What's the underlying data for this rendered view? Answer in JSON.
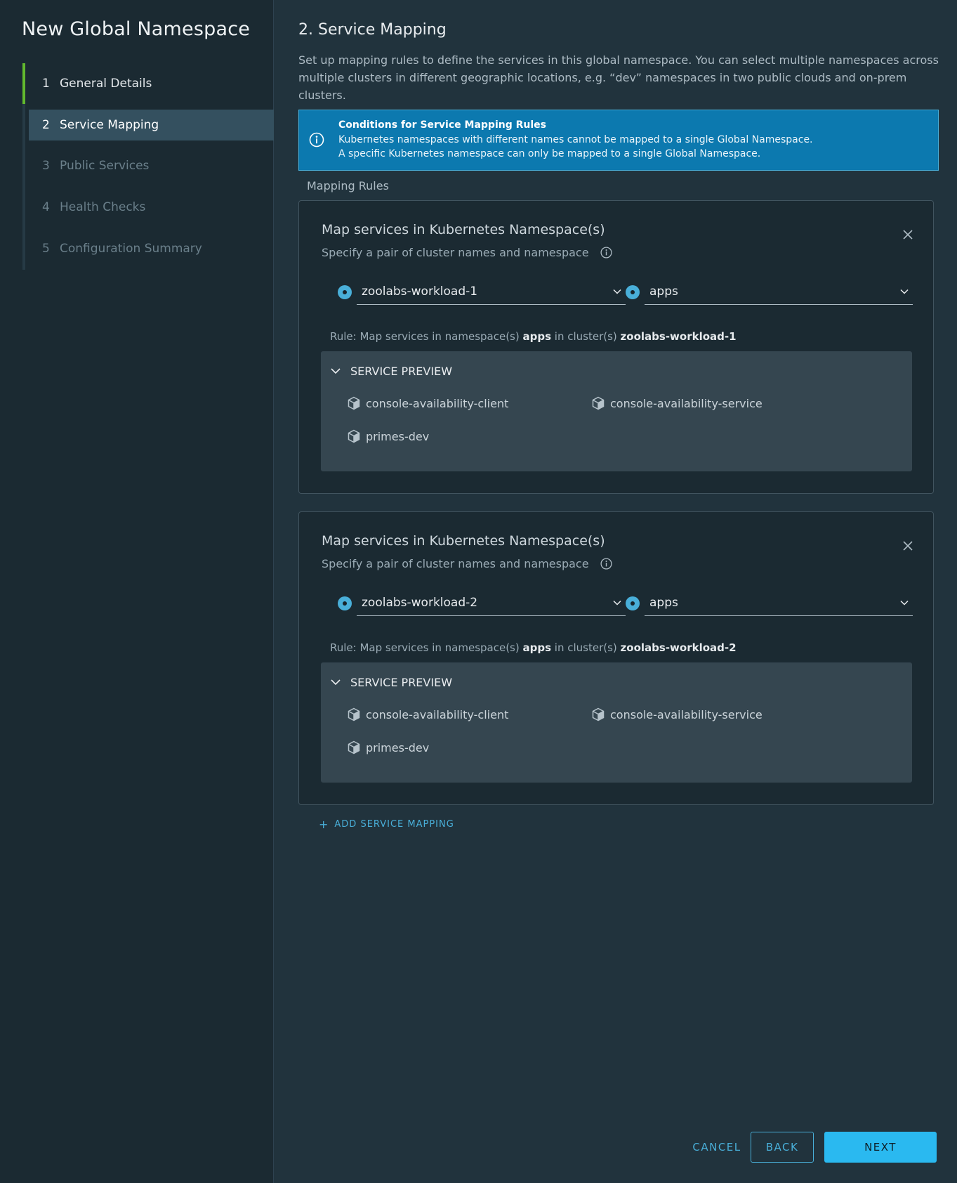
{
  "wizard": {
    "title": "New Global Namespace",
    "steps": [
      {
        "number": "1",
        "label": "General Details"
      },
      {
        "number": "2",
        "label": "Service Mapping"
      },
      {
        "number": "3",
        "label": "Public Services"
      },
      {
        "number": "4",
        "label": "Health Checks"
      },
      {
        "number": "5",
        "label": "Configuration Summary"
      }
    ],
    "active_step": 2
  },
  "main": {
    "heading": "2. Service Mapping",
    "intro": "Set up mapping rules to define the services in this global namespace. You can select multiple namespaces across multiple clusters in different geographic locations, e.g. “dev” namespaces in two public clouds and on-prem clusters.",
    "alert": {
      "title": "Conditions for Service Mapping Rules",
      "line1": "Kubernetes namespaces with different names cannot be mapped to a single Global Namespace.",
      "line2": "A specific Kubernetes namespace can only be mapped to a single Global Namespace."
    },
    "section_label": "Mapping Rules",
    "rules": [
      {
        "title": "Map services in Kubernetes Namespace(s)",
        "subtitle": "Specify a pair of cluster names and namespace",
        "cluster": "zoolabs-workload-1",
        "namespace": "apps",
        "rule_prefix": "Rule: Map services in namespace(s) ",
        "rule_namespace": "apps",
        "rule_middle": " in cluster(s) ",
        "rule_cluster": "zoolabs-workload-1",
        "preview_label": "SERVICE PREVIEW",
        "services": [
          "console-availability-client",
          "console-availability-service",
          "primes-dev"
        ]
      },
      {
        "title": "Map services in Kubernetes Namespace(s)",
        "subtitle": "Specify a pair of cluster names and namespace",
        "cluster": "zoolabs-workload-2",
        "namespace": "apps",
        "rule_prefix": "Rule: Map services in namespace(s) ",
        "rule_namespace": "apps",
        "rule_middle": " in cluster(s) ",
        "rule_cluster": "zoolabs-workload-2",
        "preview_label": "SERVICE PREVIEW",
        "services": [
          "console-availability-client",
          "console-availability-service",
          "primes-dev"
        ]
      }
    ],
    "add_mapping": {
      "plus": "+",
      "label": "ADD SERVICE MAPPING"
    }
  },
  "footer": {
    "cancel": "CANCEL",
    "back": "BACK",
    "next": "NEXT"
  },
  "icons": {
    "alert": "info-circle-icon",
    "info": "info-circle-icon",
    "close": "close-icon",
    "dropdown": "chevron-down-icon",
    "collapse": "chevron-down-icon",
    "service": "cube-icon"
  },
  "colors": {
    "accent": "#49afd9",
    "step_done": "#62b92e",
    "alert_bg": "#0c79af",
    "primary_button": "#2ab9f0"
  }
}
